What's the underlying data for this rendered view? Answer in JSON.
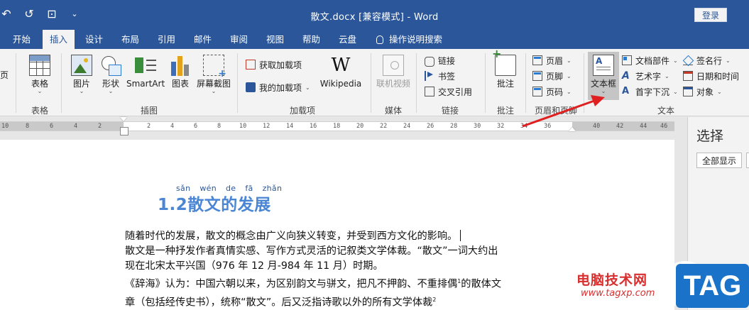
{
  "titlebar": {
    "title": "散文.docx [兼容模式]  -  Word",
    "login": "登录",
    "qat": [
      "↶",
      "↺",
      "⊡",
      "⌄"
    ]
  },
  "tabs": [
    {
      "label": "开始"
    },
    {
      "label": "插入"
    },
    {
      "label": "设计"
    },
    {
      "label": "布局"
    },
    {
      "label": "引用"
    },
    {
      "label": "邮件"
    },
    {
      "label": "审阅"
    },
    {
      "label": "视图"
    },
    {
      "label": "帮助"
    },
    {
      "label": "云盘"
    },
    {
      "label": "操作说明搜索"
    }
  ],
  "ribbon": {
    "groups": {
      "table": "表格",
      "illustrations": "插图",
      "addins": "加载项",
      "media": "媒体",
      "links": "链接",
      "comments": "批注",
      "header_footer": "页眉和页脚",
      "text": "文本"
    },
    "page_partial": "页",
    "table": "表格",
    "picture": "图片",
    "shapes": "形状",
    "smartart": "SmartArt",
    "chart": "图表",
    "screenshot": "屏幕截图",
    "get_addins": "获取加载项",
    "my_addins": "我的加载项",
    "wikipedia": "Wikipedia",
    "online_video": "联机视频",
    "link": "链接",
    "bookmark": "书签",
    "cross_ref": "交叉引用",
    "comment": "批注",
    "header": "页眉",
    "footer": "页脚",
    "page_number": "页码",
    "textbox": "文本框",
    "doc_parts": "文档部件",
    "wordart": "艺术字",
    "dropcap": "首字下沉",
    "signature": "签名行",
    "datetime": "日期和时间",
    "object": "对象"
  },
  "ruler": {
    "ticks": [
      "10",
      "8",
      "6",
      "4",
      "2",
      "2",
      "4",
      "6",
      "8",
      "10",
      "12",
      "14",
      "16",
      "18",
      "20",
      "22",
      "24",
      "26",
      "28",
      "30",
      "32",
      "34",
      "36",
      "38",
      "40",
      "42",
      "44",
      "46"
    ]
  },
  "document": {
    "ruby": [
      "sǎn",
      "wén",
      "de",
      "fā",
      "zhǎn"
    ],
    "heading": "1.2散文的发展",
    "lines": [
      "随着时代的发展，散文的概念由广义向狭义转变，并受到西方文化的影响。",
      "散文是一种抒发作者真情实感、写作方式灵活的记叙类文学体裁。“散文”一词大约出",
      "现在北宋太平兴国（976 年 12 月-984 年 11 月）时期。",
      "《辞海》认为：中国六朝以来，为区别韵文与骈文，把凡不押韵、不重排偶",
      "的散体文",
      "章（包括经传史书），统称“散文”。后又泛指诗歌以外的所有文学体裁"
    ],
    "footnote_1": "1",
    "footnote_2": "2"
  },
  "pane": {
    "title": "选择",
    "show_all": "全部显示"
  },
  "watermark": {
    "text": "电脑技术网",
    "url": "www.tagxp.com",
    "tag": "TAG"
  },
  "colors": {
    "brand": "#2b579a",
    "heading": "#4a86d4",
    "arrow": "#e02020"
  }
}
